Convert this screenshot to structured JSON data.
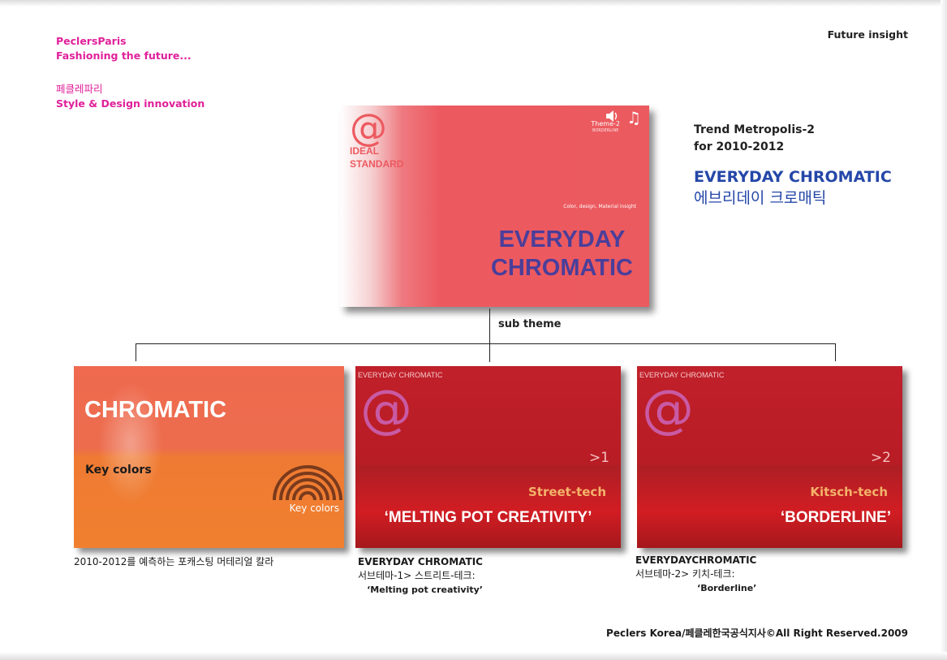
{
  "brand": {
    "line1": "PeclersParis",
    "line2": "Fashioning the future...",
    "line3": "페클레파리",
    "line4": "Style & Design innovation",
    "color": "#e0209a"
  },
  "header_right": "Future insight",
  "main_card": {
    "at_symbol": "@",
    "brand_line1": "IDEAL",
    "brand_line2": "STANDARD",
    "theme_tag": "Theme-2",
    "theme_tag_sub": "BORDERLINE",
    "insight_line": "Color, design, Material insight",
    "title_line1": "EVERYDAY",
    "title_line2": "CHROMATIC",
    "speaker_icon": "speaker-icon",
    "music_icon": "music-note-icon"
  },
  "trend": {
    "line1": "Trend Metropolis-2",
    "line2": "for 2010-2012",
    "title_en": "EVERYDAY CHROMATIC",
    "title_kr": "에브리데이 크로매틱",
    "title_color": "#2547a8"
  },
  "sub_theme_label": "sub theme",
  "cards": [
    {
      "title": "CHROMATIC",
      "subtitle": "Key colors",
      "corner_label": "Key colors",
      "icon": "rainbow-arc-icon",
      "caption": "2010-2012를 예측하는 포캐스팅 머테리얼 칼라"
    },
    {
      "label": "EVERYDAY CHROMATIC",
      "at_symbol": "@",
      "number": ">1",
      "sub": "Street-tech",
      "quote": "‘MELTING POT CREATIVITY’",
      "caption_line1": "EVERYDAY CHROMATIC",
      "caption_line2": "서브테마-1> 스트리트-테크:",
      "caption_line3": "‘Melting pot creativity’"
    },
    {
      "label": "EVERYDAY CHROMATIC",
      "at_symbol": "@",
      "number": ">2",
      "sub": "Kitsch-tech",
      "quote": "‘BORDERLINE’",
      "caption_line1": "EVERYDAYCHROMATIC",
      "caption_line2": "서브테마-2> 키치-테크:",
      "caption_line3": "‘Borderline’"
    }
  ],
  "footer": "Peclers Korea/페클레한국공식지사©All Right Reserved.2009"
}
